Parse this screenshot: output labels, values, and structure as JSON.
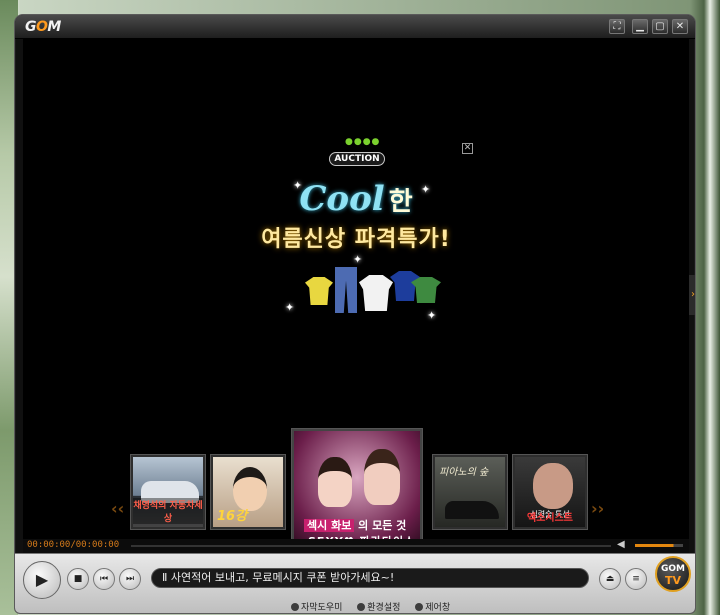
{
  "app": {
    "logo_text_g": "G",
    "logo_text_o": "O",
    "logo_text_m": "M"
  },
  "titlebar": {
    "buttons": [
      "⛶",
      "▁",
      "▢",
      "✕"
    ]
  },
  "ad": {
    "brand_dots": "●●●●",
    "brand": "AUCTION",
    "close": "✕",
    "headline_en": "Cool",
    "headline_ko": "한",
    "subline": "여름신상 파격특가!"
  },
  "thumbnails": [
    {
      "caption": "채영석의 자동차세상"
    },
    {
      "caption": "16강"
    },
    {
      "caption_line1_a": "섹시 화보",
      "caption_line1_b": "의 모든 것",
      "caption_line2_a": "SEXY♥",
      "caption_line2_b": "파라다이스"
    },
    {
      "title": "피아노의 숲"
    },
    {
      "subtitle": "심령술 특선",
      "caption": "엑소시스트"
    }
  ],
  "nav": {
    "prev": "‹‹",
    "next": "››"
  },
  "timeline": {
    "time": "00:00:00/00:00:00",
    "volume_icon": "◀",
    "volume_level": 0.8
  },
  "controls": {
    "play": "▶",
    "stop": "■",
    "prev": "⏮",
    "next": "⏭",
    "ticker": "Ⅱ 사연적어 보내고, 무료메시지 쿠폰 받아가세요~!",
    "eject": "⏏",
    "menu": "≡",
    "gomtv_line1": "GOM",
    "gomtv_line2": "TV"
  },
  "bottom_links": [
    "자막도우미",
    "환경설정",
    "제어창"
  ]
}
